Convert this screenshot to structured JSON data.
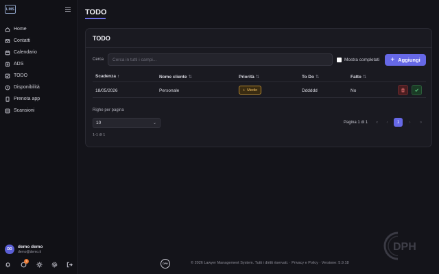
{
  "app": {
    "logo_text": "LMS"
  },
  "sidebar": {
    "items": [
      {
        "label": "Home",
        "icon": "home-icon"
      },
      {
        "label": "Contatti",
        "icon": "contacts-icon"
      },
      {
        "label": "Calendario",
        "icon": "calendar-icon"
      },
      {
        "label": "ADS",
        "icon": "ads-icon"
      },
      {
        "label": "TODO",
        "icon": "todo-icon"
      },
      {
        "label": "Disponibilità",
        "icon": "clock-icon"
      },
      {
        "label": "Prenota app",
        "icon": "phone-icon"
      },
      {
        "label": "Scansioni",
        "icon": "scan-icon"
      }
    ],
    "user": {
      "initials": "DD",
      "name": "demo demo",
      "email": "demo@demo.it"
    },
    "notification_count": "3"
  },
  "page": {
    "title": "TODO"
  },
  "card": {
    "title": "TODO",
    "search_label": "Cerca",
    "search_placeholder": "Cerca in tutti i campi...",
    "show_completed_label": "Mostra completati",
    "add_button_label": "Aggiungi"
  },
  "table": {
    "columns": [
      "Scadenza",
      "Nome cliente",
      "Priorità",
      "To Do",
      "Fatto"
    ],
    "sort_markers": [
      "↑",
      "⇅",
      "⇅",
      "⇅",
      "⇅"
    ],
    "rows": [
      {
        "scadenza": "18/05/2026",
        "cliente": "Personale",
        "priorita": "Medio",
        "todo": "Dddddd",
        "fatto": "No"
      }
    ]
  },
  "pagination": {
    "rows_per_page_label": "Righe per pagina",
    "rows_per_page": "10",
    "range_text": "1-1 di 1",
    "page_info": "Pagina 1 di 1",
    "first": "«",
    "prev": "‹",
    "current_page": "1",
    "next": "›",
    "last": "»"
  },
  "footer": {
    "logo_text": "DPH",
    "text": "© 2026 Lawyer Management System. Tutti i diritti riservati. · Privacy e Policy · Versione: 5.9.18"
  },
  "brand_mark_text": "DPH",
  "colors": {
    "accent": "#6668e6",
    "priority_medium": "#f0c060",
    "delete": "#e06b6b",
    "done": "#62d48a"
  }
}
